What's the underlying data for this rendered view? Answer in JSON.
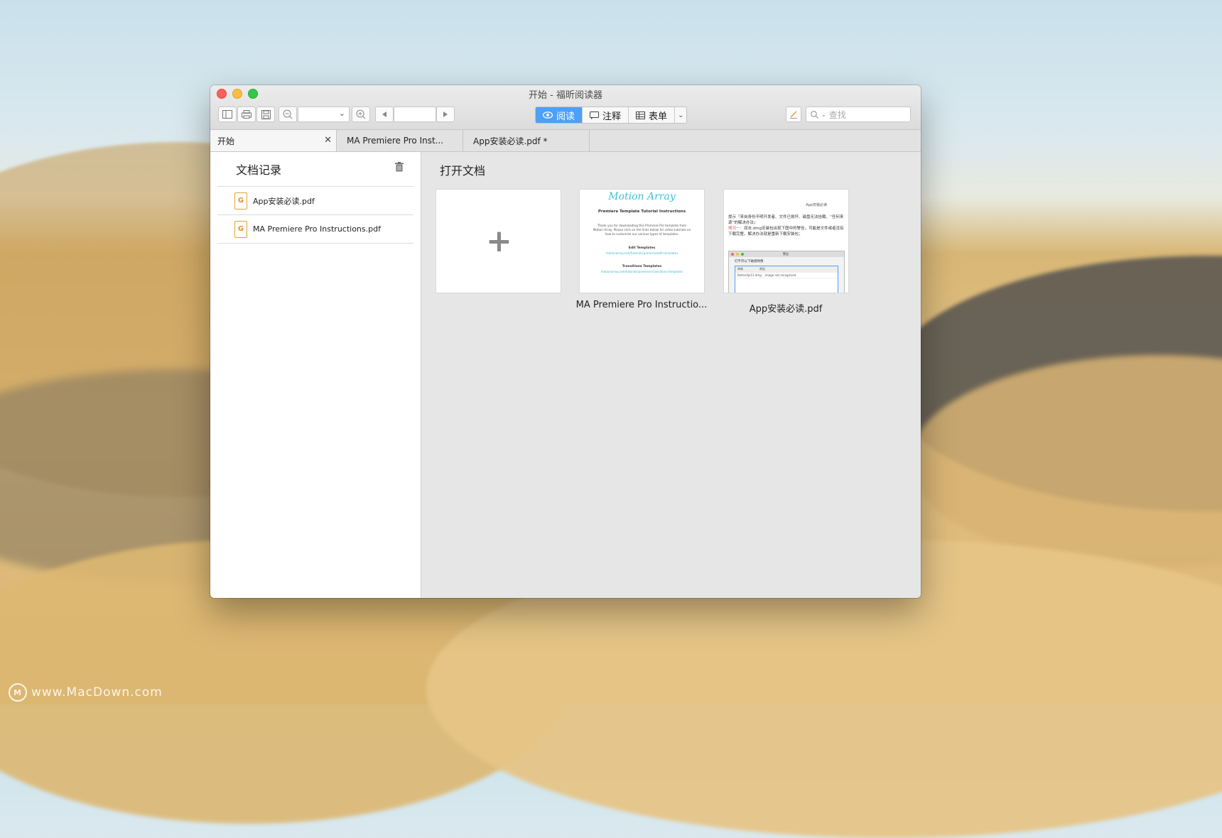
{
  "window": {
    "title": "开始 - 福昕阅读器"
  },
  "toolbar": {
    "modes": [
      {
        "label": "阅读",
        "active": true
      },
      {
        "label": "注释",
        "active": false
      },
      {
        "label": "表单",
        "active": false
      }
    ],
    "search_placeholder": "查找",
    "accent_color": "#4d9ff7"
  },
  "tabs": [
    {
      "label": "开始",
      "closable": true,
      "active": true
    },
    {
      "label": "MA Premiere Pro Inst..."
    },
    {
      "label": "App安装必读.pdf *"
    }
  ],
  "sidebar": {
    "title": "文档记录",
    "items": [
      {
        "label": "App安装必读.pdf",
        "icon": "pdf-file-icon"
      },
      {
        "label": "MA Premiere Pro Instructions.pdf",
        "icon": "pdf-file-icon"
      }
    ]
  },
  "main": {
    "title": "打开文档",
    "cards": [
      {
        "label": "MA Premiere Pro Instructio..."
      },
      {
        "label": "App安装必读.pdf"
      }
    ],
    "thumb_ma": {
      "logo": "Motion Array",
      "heading": "Premiere Template Tutorial Instructions",
      "body": "Thank you for downloading this Premiere Pro template from Motion Array. Please click on the links below for video tutorials on how to customize our various types of templates.",
      "sub1": "Edit Templates",
      "link1": "motionarray.com/tutorials/premiere/edit-templates",
      "sub2": "Transitions Templates",
      "link2": "motionarray.com/tutorials/premiere-transitions-templates"
    },
    "thumb_app": {
      "heading": "App安装必读",
      "line1": "提示『来自身份不明开发者、文件已损坏、磁盘无法挂载、“任何来源”的解决办法』",
      "red": "情况一：",
      "line2": "双击.dmg安装包出现下图中的警告，可能是文件或者没有下载完整，解决办法就是重新下载安装包；",
      "win_title": "警告",
      "win_text": "打不开以下磁盘映像",
      "col1": "映像",
      "col2": "原因",
      "row_name": "Betterdjx12.dmg",
      "row_reason": "image not recognized"
    }
  },
  "watermark": "www.MacDown.com"
}
